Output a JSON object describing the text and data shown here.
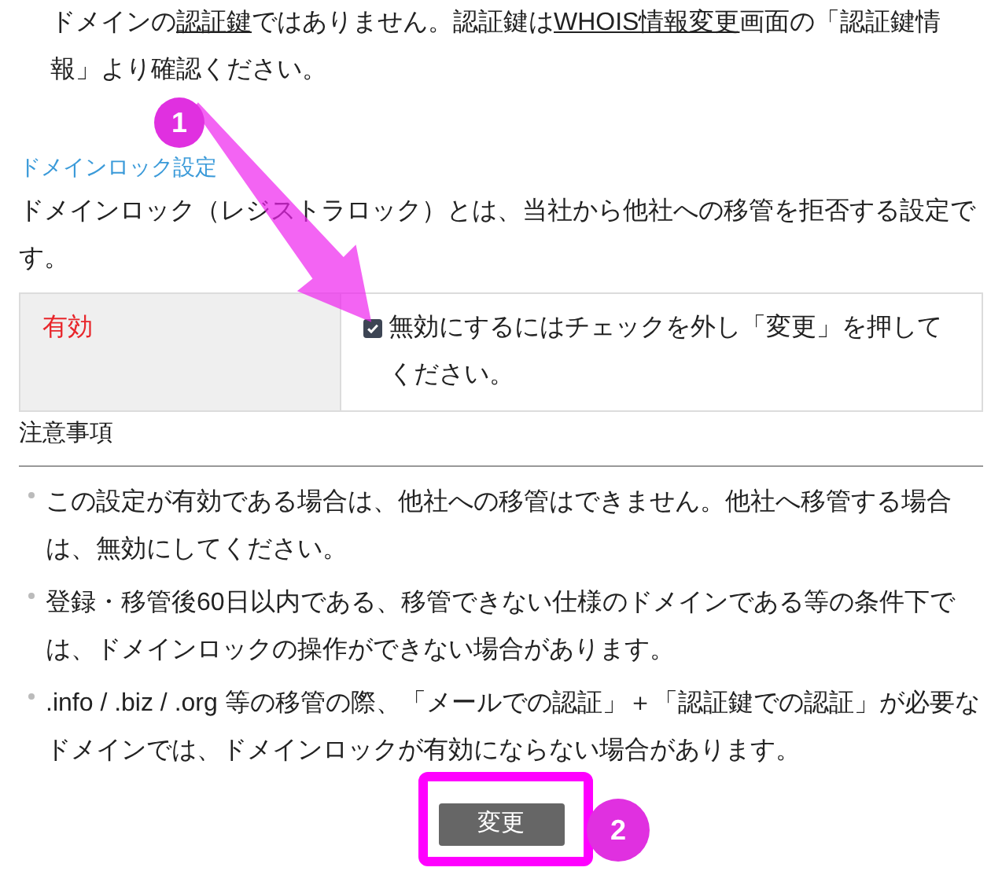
{
  "intro": [
    {
      "kind": "text",
      "text": "ドメインの"
    },
    {
      "kind": "link",
      "text": "認証鍵"
    },
    {
      "kind": "text",
      "text": "ではありません。認証鍵は"
    },
    {
      "kind": "link",
      "text": "WHOIS情報変更"
    },
    {
      "kind": "text",
      "text": "画面の「認証鍵情報」より確認ください。"
    }
  ],
  "section": {
    "title": "ドメインロック設定",
    "description": "ドメインロック（レジストラロック）とは、当社から他社への移管を拒否する設定です。"
  },
  "setting": {
    "status": "有効",
    "checked": true,
    "label": "無効にするにはチェックを外し「変更」を押してください。"
  },
  "notes": {
    "title": "注意事項",
    "items": [
      "この設定が有効である場合は、他社への移管はできません。他社へ移管する場合は、無効にしてください。",
      "登録・移管後60日以内である、移管できない仕様のドメインである等の条件下では、ドメインロックの操作ができない場合があります。",
      ".info / .biz / .org 等の移管の際、「メールでの認証」＋「認証鍵での認証」が必要なドメインでは、ドメインロックが有効にならない場合があります。"
    ]
  },
  "button": "変更",
  "annotations": [
    "1",
    "2"
  ]
}
